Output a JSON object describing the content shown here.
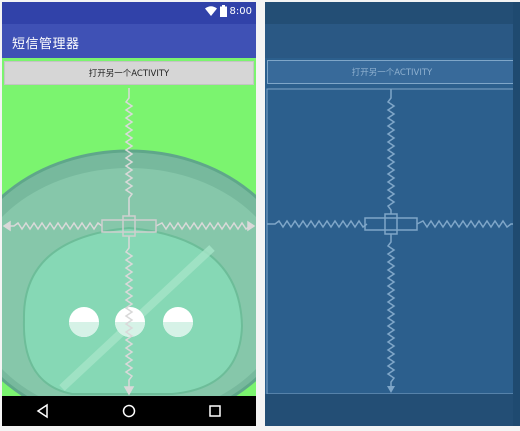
{
  "status_bar": {
    "time": "8:00",
    "icons": [
      "wifi-icon",
      "battery-icon"
    ]
  },
  "app_bar": {
    "title": "短信管理器"
  },
  "content": {
    "open_button_label": "打开另一个ACTIVITY",
    "background_color": "#7bf46f"
  },
  "blueprint": {
    "open_button_label": "打开另一个ACTIVITY"
  },
  "nav_bar": {
    "buttons": [
      "back-icon",
      "home-icon",
      "recents-icon"
    ]
  },
  "colors": {
    "primary": "#3f51b5",
    "primary_dark": "#3142a9",
    "blueprint_bg": "#2c5f8d"
  }
}
